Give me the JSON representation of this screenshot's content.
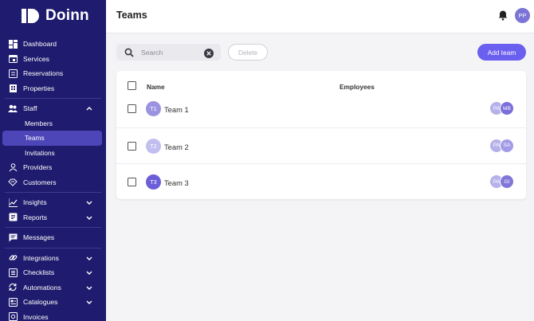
{
  "brand": {
    "name": "Doinn",
    "accent": "#6b5ff0",
    "sidebar_bg": "#1f1b6e"
  },
  "sidebar": {
    "items": [
      {
        "label": "Dashboard",
        "icon": "dashboard-icon"
      },
      {
        "label": "Services",
        "icon": "calendar-icon"
      },
      {
        "label": "Reservations",
        "icon": "reservations-icon"
      },
      {
        "label": "Properties",
        "icon": "building-icon"
      },
      {
        "label": "Staff",
        "icon": "people-icon",
        "expanded": true
      },
      {
        "label": "Members"
      },
      {
        "label": "Teams",
        "active": true
      },
      {
        "label": "Invitations"
      },
      {
        "label": "Providers",
        "icon": "provider-icon"
      },
      {
        "label": "Customers",
        "icon": "handshake-icon"
      },
      {
        "label": "Insights",
        "icon": "chart-line-icon"
      },
      {
        "label": "Reports",
        "icon": "report-icon"
      },
      {
        "label": "Messages",
        "icon": "message-icon"
      },
      {
        "label": "Integrations",
        "icon": "link-icon"
      },
      {
        "label": "Checklists",
        "icon": "checklist-icon"
      },
      {
        "label": "Automations",
        "icon": "automation-icon"
      },
      {
        "label": "Catalogues",
        "icon": "catalogue-icon"
      },
      {
        "label": "Invoices",
        "icon": "invoice-icon"
      }
    ]
  },
  "header": {
    "title": "Teams",
    "user_initials": "PP"
  },
  "toolbar": {
    "search_placeholder": "Search",
    "delete_label": "Delete",
    "add_label": "Add team"
  },
  "table": {
    "columns": [
      "Name",
      "Employees"
    ],
    "rows": [
      {
        "initials": "T1",
        "name": "Team 1",
        "color": "#9b93e0",
        "employees": [
          {
            "initials": "PA",
            "color": "#b7b1ea"
          },
          {
            "initials": "MB",
            "color": "#7b6fdc"
          }
        ]
      },
      {
        "initials": "T2",
        "name": "Team 2",
        "color": "#c3bef0",
        "employees": [
          {
            "initials": "PA",
            "color": "#b7b1ea"
          },
          {
            "initials": "SA",
            "color": "#a39be6"
          }
        ]
      },
      {
        "initials": "T3",
        "name": "Team 3",
        "color": "#6b5ed8",
        "employees": [
          {
            "initials": "PA",
            "color": "#b7b1ea"
          },
          {
            "initials": "GI",
            "color": "#8177d8"
          }
        ]
      }
    ]
  }
}
